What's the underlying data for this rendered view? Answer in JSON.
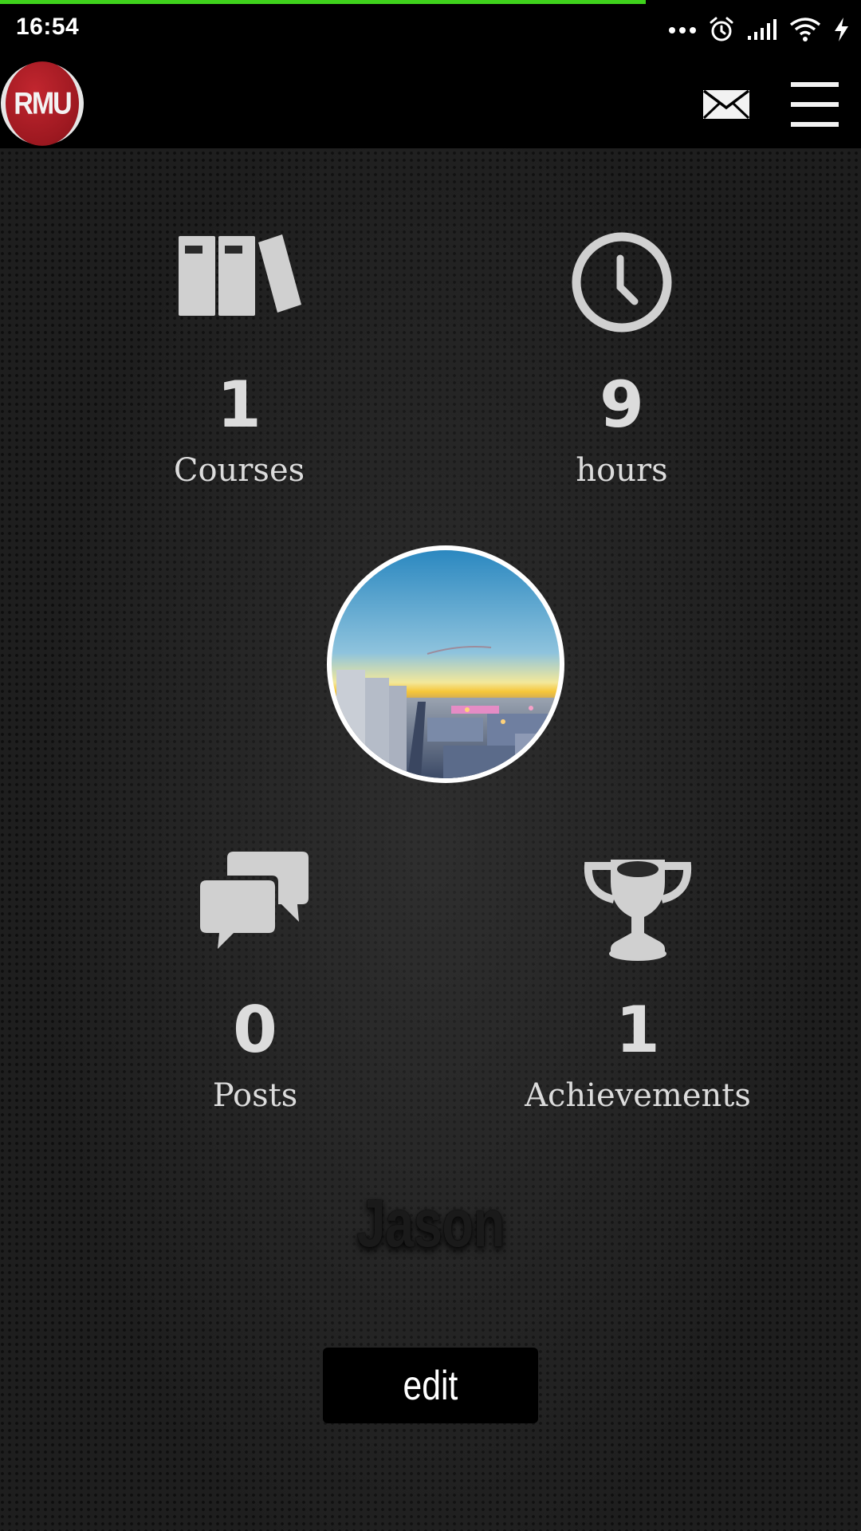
{
  "status_bar": {
    "time": "16:54",
    "icons": [
      "more-dots-icon",
      "alarm-icon",
      "signal-icon",
      "wifi-icon",
      "charging-icon"
    ]
  },
  "page_load_progress": 0.75,
  "header": {
    "logo_text": "RMU",
    "icons": [
      "mail-icon",
      "hamburger-menu-icon"
    ]
  },
  "stats": {
    "courses": {
      "value": "1",
      "label": "Courses",
      "icon": "books-icon"
    },
    "hours": {
      "value": "9",
      "label": "hours",
      "icon": "clock-icon"
    },
    "posts": {
      "value": "0",
      "label": "Posts",
      "icon": "chat-bubbles-icon"
    },
    "achievements": {
      "value": "1",
      "label": "Achievements",
      "icon": "trophy-icon"
    }
  },
  "profile": {
    "name": "Jason",
    "edit_label": "edit"
  },
  "colors": {
    "progress_green": "#3fd21c",
    "logo_red": "#b11f28",
    "stat_gray": "#dcdcdc"
  }
}
